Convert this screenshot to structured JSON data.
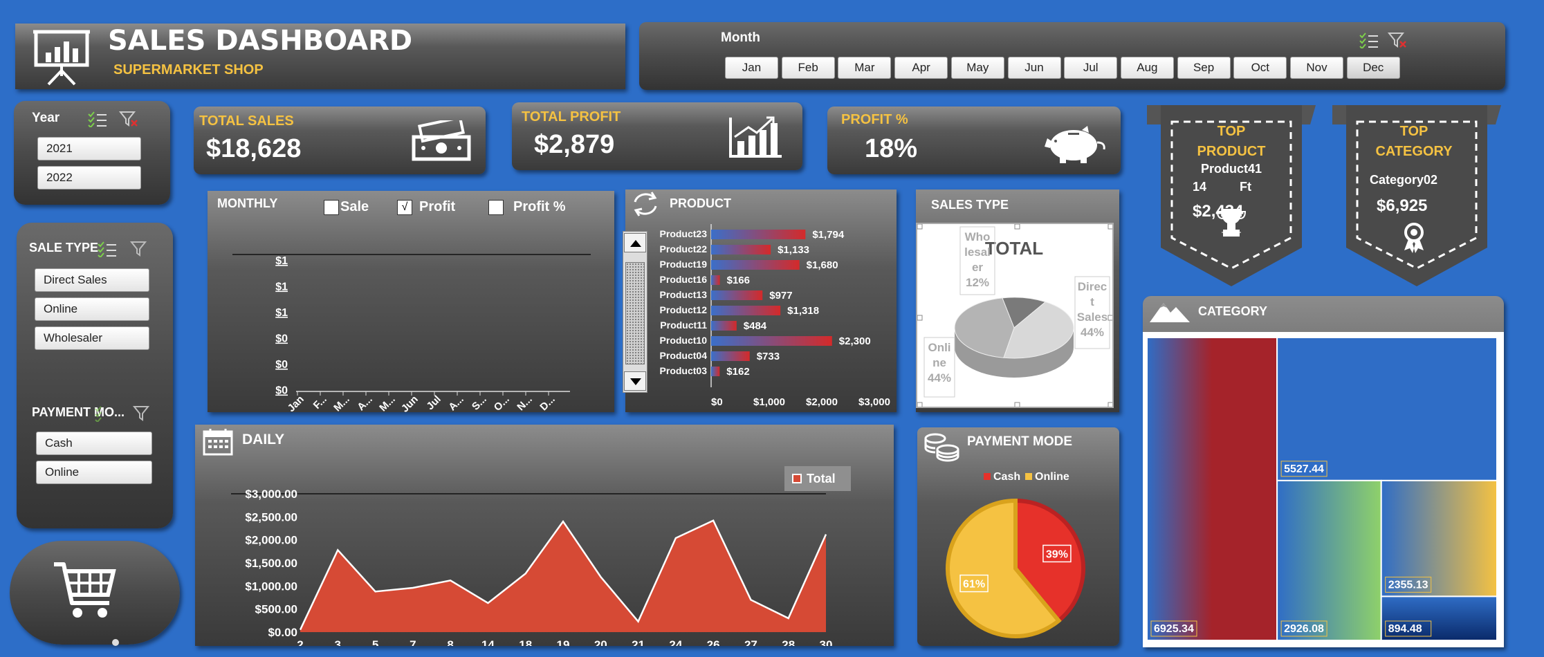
{
  "header": {
    "title": "SALES DASHBOARD",
    "subtitle": "SUPERMARKET SHOP"
  },
  "month_slicer": {
    "label": "Month",
    "items": [
      "Jan",
      "Feb",
      "Mar",
      "Apr",
      "May",
      "Jun",
      "Jul",
      "Aug",
      "Sep",
      "Oct",
      "Nov",
      "Dec"
    ]
  },
  "year_slicer": {
    "label": "Year",
    "items": [
      "2021",
      "2022"
    ]
  },
  "sale_type_slicer": {
    "label": "SALE TYPE",
    "items": [
      "Direct Sales",
      "Online",
      "Wholesaler"
    ]
  },
  "payment_slicer": {
    "label": "PAYMENT MO...",
    "items": [
      "Cash",
      "Online"
    ]
  },
  "kpis": {
    "total_sales": {
      "label": "TOTAL SALES",
      "value": "$18,628"
    },
    "total_profit": {
      "label": "TOTAL PROFIT",
      "value": "$2,879"
    },
    "profit_pct": {
      "label": "PROFIT %",
      "value": "18%"
    }
  },
  "top_product": {
    "title": "TOP PRODUCT",
    "name_line1": "Product41",
    "name_line2a": "14",
    "name_line2b": "Ft",
    "value": "$2,434"
  },
  "top_category": {
    "title": "TOP CATEGORY",
    "name": "Category02",
    "value": "$6,925"
  },
  "monthly": {
    "title": "MONTHLY",
    "checks": [
      {
        "label": "Sale",
        "checked": false
      },
      {
        "label": "Profit",
        "checked": true
      },
      {
        "label": "Profit %",
        "checked": false
      }
    ],
    "check_mark": "√"
  },
  "product": {
    "title": "PRODUCT"
  },
  "sales_type": {
    "title": "SALES TYPE"
  },
  "daily": {
    "title": "DAILY"
  },
  "payment_mode": {
    "title": "PAYMENT MODE"
  },
  "category": {
    "title": "CATEGORY"
  },
  "chart_data": [
    {
      "type": "line",
      "title": "",
      "categories": [
        "Jan",
        "F...",
        "M...",
        "A...",
        "M...",
        "Jun",
        "Jul",
        "A...",
        "S...",
        "O...",
        "N...",
        "D..."
      ],
      "y_tick_labels": [
        "$1",
        "$1",
        "$1",
        "$0",
        "$0",
        "$0"
      ],
      "series": []
    },
    {
      "type": "bar",
      "orientation": "horizontal",
      "categories": [
        "Product23",
        "Product22",
        "Product19",
        "Product16",
        "Product13",
        "Product12",
        "Product11",
        "Product10",
        "Product04",
        "Product03"
      ],
      "values": [
        1794,
        1133,
        1680,
        166,
        977,
        1318,
        484,
        2300,
        733,
        162
      ],
      "value_labels": [
        "$1,794",
        "$1,133",
        "$1,680",
        "$166",
        "$977",
        "$1,318",
        "$484",
        "$2,300",
        "$733",
        "$162"
      ],
      "x_tick_labels": [
        "$0",
        "$1,000",
        "$2,000",
        "$3,000"
      ],
      "xlim": [
        0,
        3000
      ],
      "colors": [
        "#3b6fc9",
        "#d42a2a"
      ]
    },
    {
      "type": "pie",
      "title": "TOTAL",
      "labels": [
        "Wholesaler",
        "Direct Sales",
        "Online"
      ],
      "label_texts": [
        "Who lesal er",
        "Direc t Sales",
        "Onli ne"
      ],
      "values": [
        12,
        44,
        44
      ],
      "value_labels": [
        "12%",
        "44%",
        "44%"
      ]
    },
    {
      "type": "area",
      "categories": [
        "2",
        "3",
        "5",
        "7",
        "8",
        "14",
        "18",
        "19",
        "20",
        "21",
        "24",
        "26",
        "27",
        "28",
        "30"
      ],
      "values": [
        50,
        1780,
        880,
        960,
        1120,
        630,
        1270,
        2400,
        1200,
        230,
        2040,
        2420,
        700,
        300,
        2120
      ],
      "y_tick_labels": [
        "$0.00",
        "$500.00",
        "$1,000.00",
        "$1,500.00",
        "$2,000.00",
        "$2,500.00",
        "$3,000.00"
      ],
      "ylim": [
        0,
        3000
      ],
      "legend": [
        "Total"
      ],
      "legend_position": "top-right",
      "colors": [
        "#d64a35"
      ]
    },
    {
      "type": "pie",
      "labels": [
        "Cash",
        "Online"
      ],
      "values": [
        39,
        61
      ],
      "value_labels": [
        "39%",
        "61%"
      ],
      "legend_position": "top",
      "colors": [
        "#e6312a",
        "#f5c242"
      ]
    },
    {
      "type": "treemap",
      "values": [
        6925.34,
        5527.44,
        2926.08,
        2355.13,
        894.48
      ],
      "value_labels": [
        "6925.34",
        "5527.44",
        "2926.08",
        "2355.13",
        "894.48"
      ]
    }
  ]
}
